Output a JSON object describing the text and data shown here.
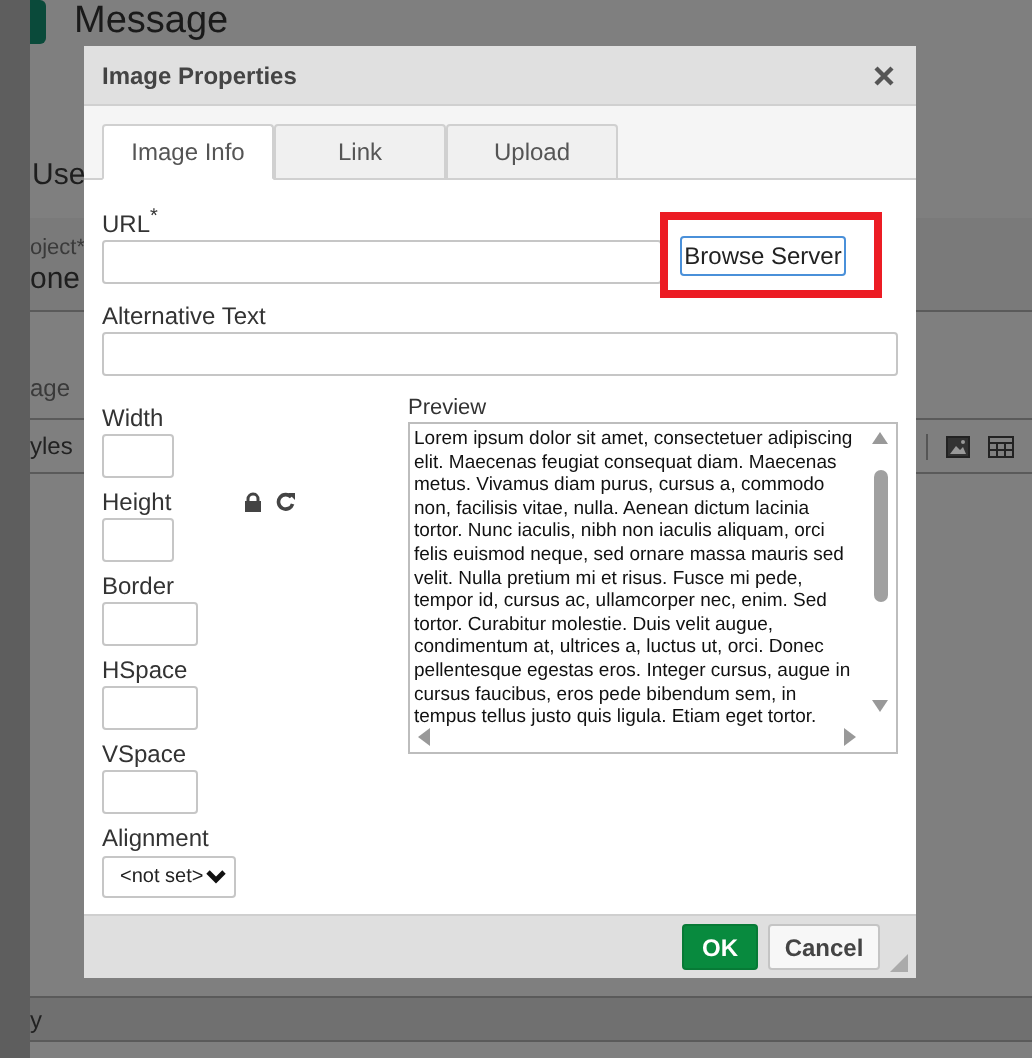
{
  "page": {
    "heading": "Message",
    "use_label": "Use",
    "subject_label": "oject*",
    "subject_value": "one",
    "section_label": "age",
    "toolbar_label": "yles",
    "footer_label": "y"
  },
  "dialog": {
    "title": "Image Properties",
    "tabs": [
      {
        "label": "Image Info",
        "selected": true
      },
      {
        "label": "Link",
        "selected": false
      },
      {
        "label": "Upload",
        "selected": false
      }
    ],
    "url": {
      "label": "URL$^{*}$"
    },
    "browse_button": {
      "label": "Browse Server",
      "highlighted": true
    },
    "alt_text": {
      "label": "Alternative Text"
    },
    "size_fields": [
      {
        "label": "Width"
      },
      {
        "label": "Height"
      }
    ],
    "spacing_fields": [
      {
        "label": "Border"
      },
      {
        "label": "HSpace"
      },
      {
        "label": "VSpace"
      }
    ],
    "alignment": {
      "label": "Alignment",
      "value": "<not set>"
    },
    "preview": {
      "label": "Preview",
      "lines": [
        "Lorem ipsum dolor sit amet, consectetuer adipiscing",
        "elit. Maecenas feugiat consequat diam. Maecenas",
        "metus. Vivamus diam purus, cursus a, commodo",
        "non, facilisis vitae, nulla. Aenean dictum lacinia",
        "tortor. Nunc iaculis, nibh non iaculis aliquam, orci",
        "felis euismod neque, sed ornare massa mauris sed",
        "velit. Nulla pretium mi et risus. Fusce mi pede,",
        "tempor id, cursus ac, ullamcorper nec, enim. Sed",
        "tortor. Curabitur molestie. Duis velit augue,",
        "condimentum at, ultrices a, luctus ut, orci. Donec",
        "pellentesque egestas eros. Integer cursus, augue in",
        "cursus faucibus, eros pede bibendum sem, in",
        "tempus tellus justo quis ligula. Etiam eget tortor."
      ]
    },
    "buttons": [
      {
        "label": "OK",
        "kind": "primary"
      },
      {
        "label": "Cancel",
        "kind": "secondary"
      }
    ]
  }
}
